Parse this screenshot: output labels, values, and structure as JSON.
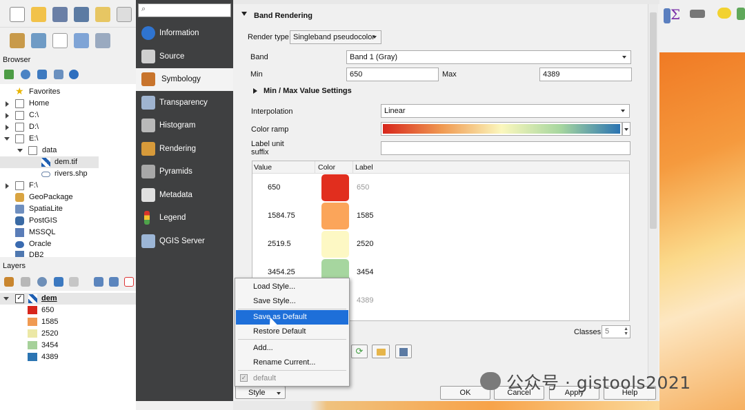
{
  "browser": {
    "title": "Browser",
    "items": [
      {
        "label": "Favorites"
      },
      {
        "label": "Home"
      },
      {
        "label": "C:\\"
      },
      {
        "label": "D:\\"
      },
      {
        "label": "E:\\"
      },
      {
        "label": "data"
      },
      {
        "label": "dem.tif"
      },
      {
        "label": "rivers.shp"
      },
      {
        "label": "F:\\"
      },
      {
        "label": "GeoPackage"
      },
      {
        "label": "SpatiaLite"
      },
      {
        "label": "PostGIS"
      },
      {
        "label": "MSSQL"
      },
      {
        "label": "Oracle"
      },
      {
        "label": "DB2"
      }
    ]
  },
  "layers": {
    "title": "Layers",
    "layer_name": "dem",
    "legend": [
      {
        "label": "650",
        "color": "#d7261c"
      },
      {
        "label": "1585",
        "color": "#f09a52"
      },
      {
        "label": "2520",
        "color": "#ece8a6"
      },
      {
        "label": "3454",
        "color": "#a6d19a"
      },
      {
        "label": "4389",
        "color": "#2b74b2"
      }
    ]
  },
  "sidebar": {
    "items": [
      {
        "label": "Information",
        "icon": "info-icon",
        "color": "#2f74d0"
      },
      {
        "label": "Source",
        "icon": "source-icon",
        "color": "#cfcfcf"
      },
      {
        "label": "Symbology",
        "icon": "symbology-icon",
        "color": "#c8742c"
      },
      {
        "label": "Transparency",
        "icon": "transparency-icon",
        "color": "#9fb4d0"
      },
      {
        "label": "Histogram",
        "icon": "histogram-icon",
        "color": "#b9b9b9"
      },
      {
        "label": "Rendering",
        "icon": "rendering-icon",
        "color": "#d79a3a"
      },
      {
        "label": "Pyramids",
        "icon": "pyramids-icon",
        "color": "#a8a8a8"
      },
      {
        "label": "Metadata",
        "icon": "metadata-icon",
        "color": "#e0e0e0"
      },
      {
        "label": "Legend",
        "icon": "legend-icon",
        "color": "#d8d8d8"
      },
      {
        "label": "QGIS Server",
        "icon": "qgis-server-icon",
        "color": "#9cb6d6"
      }
    ]
  },
  "symbology": {
    "section_title": "Band Rendering",
    "render_type_label": "Render type",
    "render_type_value": "Singleband pseudocolor",
    "band_label": "Band",
    "band_value": "Band 1 (Gray)",
    "min_label": "Min",
    "min_value": "650",
    "max_label": "Max",
    "max_value": "4389",
    "minmax_section": "Min / Max Value Settings",
    "interpolation_label": "Interpolation",
    "interpolation_value": "Linear",
    "color_ramp_label": "Color ramp",
    "label_unit_label_1": "Label unit",
    "label_unit_label_2": "suffix",
    "label_unit_value": "",
    "table": {
      "headers": [
        "Value",
        "Color",
        "Label"
      ],
      "rows": [
        {
          "value": "650",
          "color": "#e12e1e",
          "label": "650"
        },
        {
          "value": "1584.75",
          "color": "#fba55a",
          "label": "1585"
        },
        {
          "value": "2519.5",
          "color": "#fdf8c4",
          "label": "2520"
        },
        {
          "value": "3454.25",
          "color": "#a6d69f",
          "label": "3454"
        },
        {
          "value": "",
          "color": "#2b74b2",
          "label": "4389"
        }
      ]
    },
    "classes_label": "Classes",
    "classes_value": "5"
  },
  "style_menu": {
    "items": [
      {
        "label": "Load Style..."
      },
      {
        "label": "Save Style..."
      },
      {
        "label": "Save as Default"
      },
      {
        "label": "Restore Default"
      },
      {
        "label": "Add..."
      },
      {
        "label": "Rename Current..."
      },
      {
        "label": "default"
      }
    ]
  },
  "buttons": {
    "style": "Style",
    "ok": "OK",
    "cancel": "Cancel",
    "apply": "Apply",
    "help": "Help"
  },
  "watermark": "公众号 · gistools2021"
}
